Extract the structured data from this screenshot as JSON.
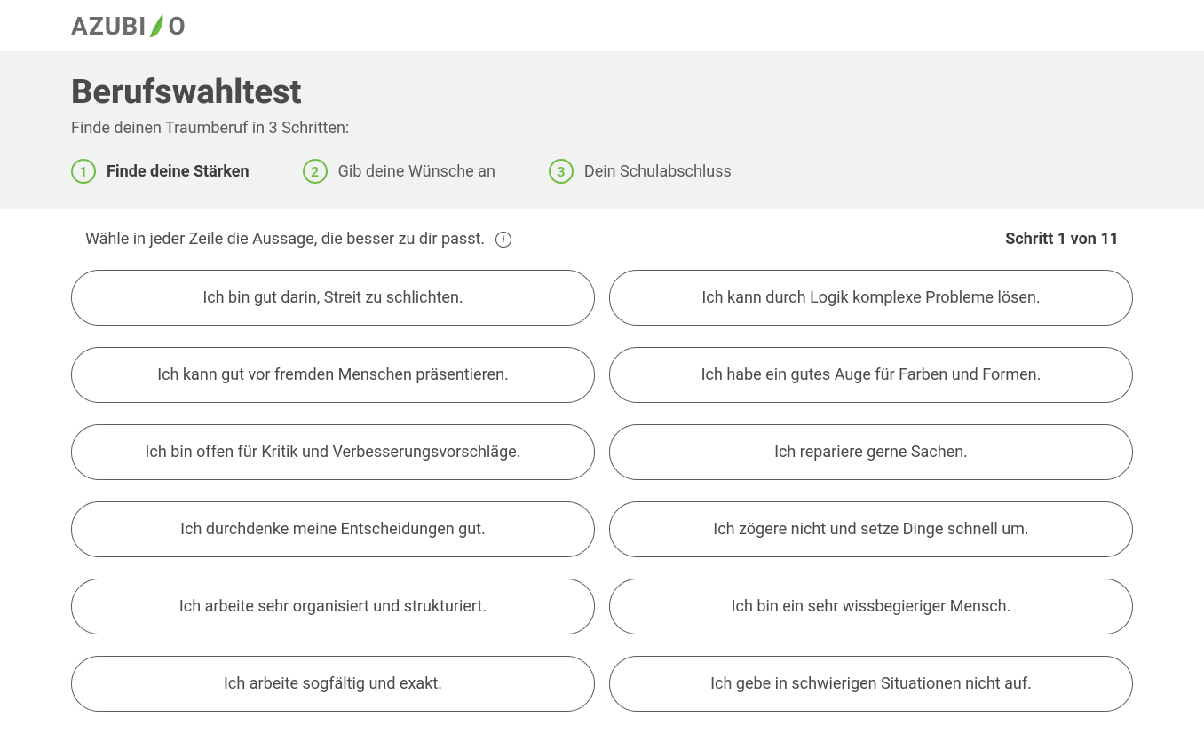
{
  "logo": {
    "text_before": "AZUBI",
    "text_after": "O"
  },
  "header": {
    "title": "Berufswahltest",
    "subtitle": "Finde deinen Traumberuf in 3 Schritten:",
    "steps": [
      {
        "num": "1",
        "label": "Finde deine Stärken",
        "active": true
      },
      {
        "num": "2",
        "label": "Gib deine Wünsche an",
        "active": false
      },
      {
        "num": "3",
        "label": "Dein Schulabschluss",
        "active": false
      }
    ]
  },
  "content": {
    "instruction": "Wähle in jeder Zeile die Aussage, die besser zu dir passt.",
    "step_counter": "Schritt 1 von 11",
    "rows": [
      {
        "left": "Ich bin gut darin, Streit zu schlichten.",
        "right": "Ich kann durch Logik komplexe Probleme lösen."
      },
      {
        "left": "Ich kann gut vor fremden Menschen präsentieren.",
        "right": "Ich habe ein gutes Auge für Farben und Formen."
      },
      {
        "left": "Ich bin offen für Kritik und Verbesserungsvorschläge.",
        "right": "Ich repariere gerne Sachen."
      },
      {
        "left": "Ich durchdenke meine Entscheidungen gut.",
        "right": "Ich zögere nicht und setze Dinge schnell um."
      },
      {
        "left": "Ich arbeite sehr organisiert und strukturiert.",
        "right": "Ich bin ein sehr wissbegieriger Mensch."
      },
      {
        "left": "Ich arbeite sogfältig und exakt.",
        "right": "Ich gebe in schwierigen Situationen nicht auf."
      }
    ]
  }
}
